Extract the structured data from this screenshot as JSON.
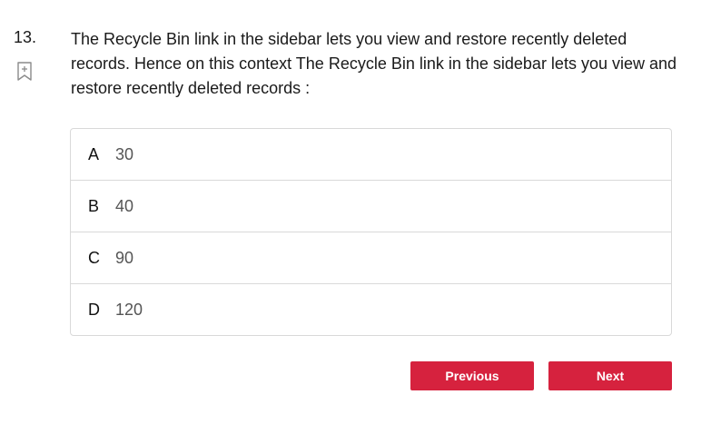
{
  "question": {
    "number": "13.",
    "text": "The Recycle Bin link in the sidebar lets you view and restore recently deleted records. Hence on this context The Recycle Bin link in the sidebar lets you view and restore recently deleted records :",
    "bookmark_icon": "bookmark-add-icon"
  },
  "options": [
    {
      "letter": "A",
      "value": "30"
    },
    {
      "letter": "B",
      "value": "40"
    },
    {
      "letter": "C",
      "value": "90"
    },
    {
      "letter": "D",
      "value": "120"
    }
  ],
  "nav": {
    "previous_label": "Previous",
    "next_label": "Next"
  },
  "colors": {
    "accent": "#d6223e",
    "border": "#d9d9d9"
  }
}
